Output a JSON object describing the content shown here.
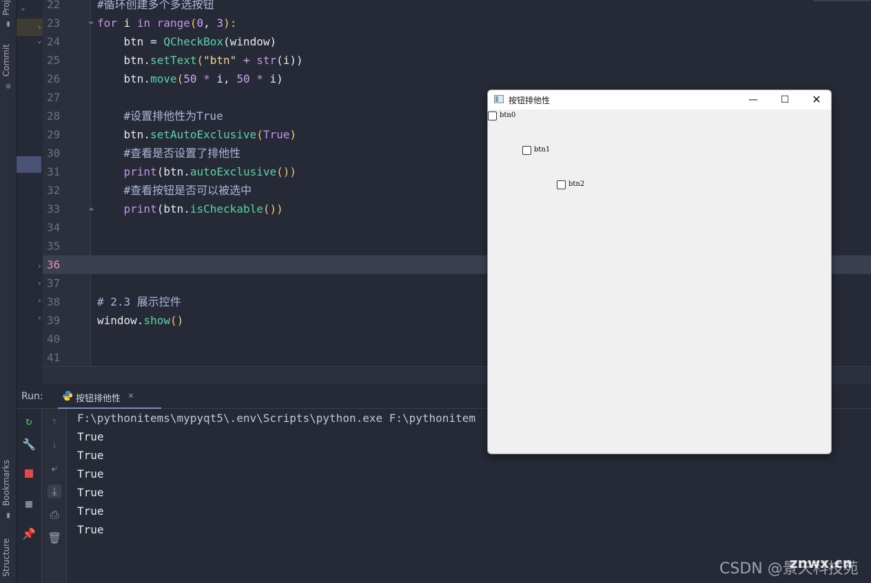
{
  "sidebar": {
    "project_label": "Proj",
    "commit_label": "Commit",
    "bookmarks_label": "Bookmarks",
    "structure_label": "Structure"
  },
  "editor": {
    "lines": [
      {
        "num": "22",
        "current": false
      },
      {
        "num": "23",
        "current": false
      },
      {
        "num": "24",
        "current": false
      },
      {
        "num": "25",
        "current": false
      },
      {
        "num": "26",
        "current": false
      },
      {
        "num": "27",
        "current": false
      },
      {
        "num": "28",
        "current": false
      },
      {
        "num": "29",
        "current": false
      },
      {
        "num": "30",
        "current": false
      },
      {
        "num": "31",
        "current": false
      },
      {
        "num": "32",
        "current": false
      },
      {
        "num": "33",
        "current": false
      },
      {
        "num": "34",
        "current": false
      },
      {
        "num": "35",
        "current": false
      },
      {
        "num": "36",
        "current": true
      },
      {
        "num": "37",
        "current": false
      },
      {
        "num": "38",
        "current": false
      },
      {
        "num": "39",
        "current": false
      },
      {
        "num": "40",
        "current": false
      },
      {
        "num": "41",
        "current": false
      }
    ],
    "code": {
      "l22": "#循环创建多个多选按钮",
      "l23_for": "for",
      "l23_i": " i ",
      "l23_in": "in",
      "l23_range": " range",
      "l23_open": "(",
      "l23_n0": "0",
      "l23_comma": ", ",
      "l23_n3": "3",
      "l23_close": "):",
      "l24_a": "    btn = ",
      "l24_fn": "QCheckBox",
      "l24_arg": "(window)",
      "l25_a": "    btn.",
      "l25_fn": "setText",
      "l25_o": "(",
      "l25_str": "\"btn\"",
      "l25_plus": " + ",
      "l25_bi": "str",
      "l25_rest": "(i))",
      "l26_a": "    btn.",
      "l26_fn": "move",
      "l26_o": "(",
      "l26_n1": "50",
      "l26_op1": " * ",
      "l26_m": "i, ",
      "l26_n2": "50",
      "l26_op2": " * ",
      "l26_rest": "i)",
      "l28": "    #设置排他性为True",
      "l29_a": "    btn.",
      "l29_fn": "setAutoExclusive",
      "l29_o": "(",
      "l29_kw": "True",
      "l29_c": ")",
      "l30": "    #查看是否设置了排他性",
      "l31_bi": "    print",
      "l31_a": "(btn.",
      "l31_fn": "autoExclusive",
      "l31_c": "())",
      "l32": "    #查看按钮是否可以被选中",
      "l33_bi": "    print",
      "l33_a": "(btn.",
      "l33_fn": "isCheckable",
      "l33_c": "())",
      "l38": "# 2.3 展示控件",
      "l39_a": "window.",
      "l39_fn": "show",
      "l39_c": "()"
    }
  },
  "run": {
    "label": "Run:",
    "tab_label": "按钮排他性",
    "console_lines": [
      "F:\\pythonitems\\mypyqt5\\.env\\Scripts\\python.exe F:\\pythonitem",
      "True",
      "True",
      "True",
      "True",
      "True",
      "True"
    ]
  },
  "qt_window": {
    "title": "按钮排他性",
    "checkboxes": [
      "btn0",
      "btn1",
      "btn2"
    ]
  },
  "watermark": {
    "csdn": "CSDN @景天科技苑",
    "site": "znwx.cn"
  }
}
